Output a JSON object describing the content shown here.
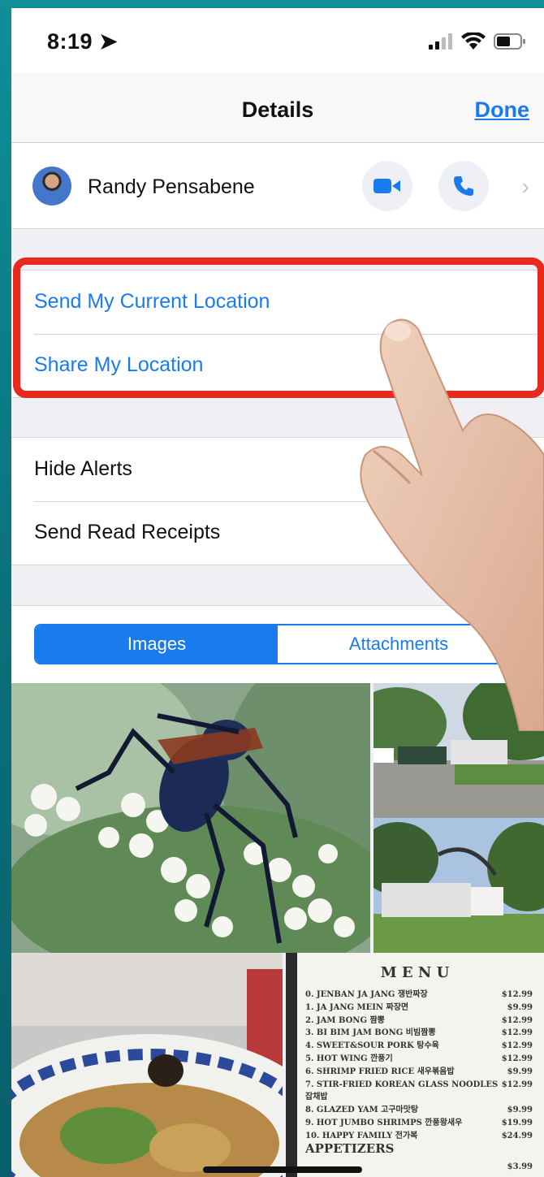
{
  "status": {
    "time": "8:19"
  },
  "nav": {
    "title": "Details",
    "done_label": "Done"
  },
  "contact": {
    "name": "Randy Pensabene"
  },
  "location": {
    "send_current": "Send My Current Location",
    "share": "Share My Location"
  },
  "settings": {
    "hide_alerts": "Hide Alerts",
    "read_receipts": "Send Read Receipts"
  },
  "segments": {
    "images": "Images",
    "attachments": "Attachments"
  },
  "menu": {
    "title": "M E N U",
    "items": [
      {
        "name": "0. JENBAN JA JANG 쟁반짜장",
        "price": "$12.99"
      },
      {
        "name": "1. JA JANG MEIN 짜장면",
        "price": "$9.99"
      },
      {
        "name": "2. JAM BONG 짬뽕",
        "price": "$12.99"
      },
      {
        "name": "3. BI BIM JAM BONG 비빔짬뽕",
        "price": "$12.99"
      },
      {
        "name": "4. SWEET&SOUR PORK 탕수육",
        "price": "$12.99"
      },
      {
        "name": "5. HOT WING 깐풍기",
        "price": "$12.99"
      },
      {
        "name": "6. SHRIMP FRIED RICE 새우볶음밥",
        "price": "$9.99"
      },
      {
        "name": "7. STIR-FRIED KOREAN GLASS NOODLES 잡채밥",
        "price": "$12.99"
      },
      {
        "name": "8. GLAZED YAM 고구마맛탕",
        "price": "$9.99"
      },
      {
        "name": "9. HOT JUMBO SHRIMPS 깐풍왕새우",
        "price": "$19.99"
      },
      {
        "name": "10. HAPPY FAMILY 전가복",
        "price": "$24.99"
      }
    ],
    "appetizers": "APPETIZERS",
    "app_price": "$3.99"
  },
  "colors": {
    "accent": "#1a7bef",
    "highlight": "#e8291d"
  }
}
